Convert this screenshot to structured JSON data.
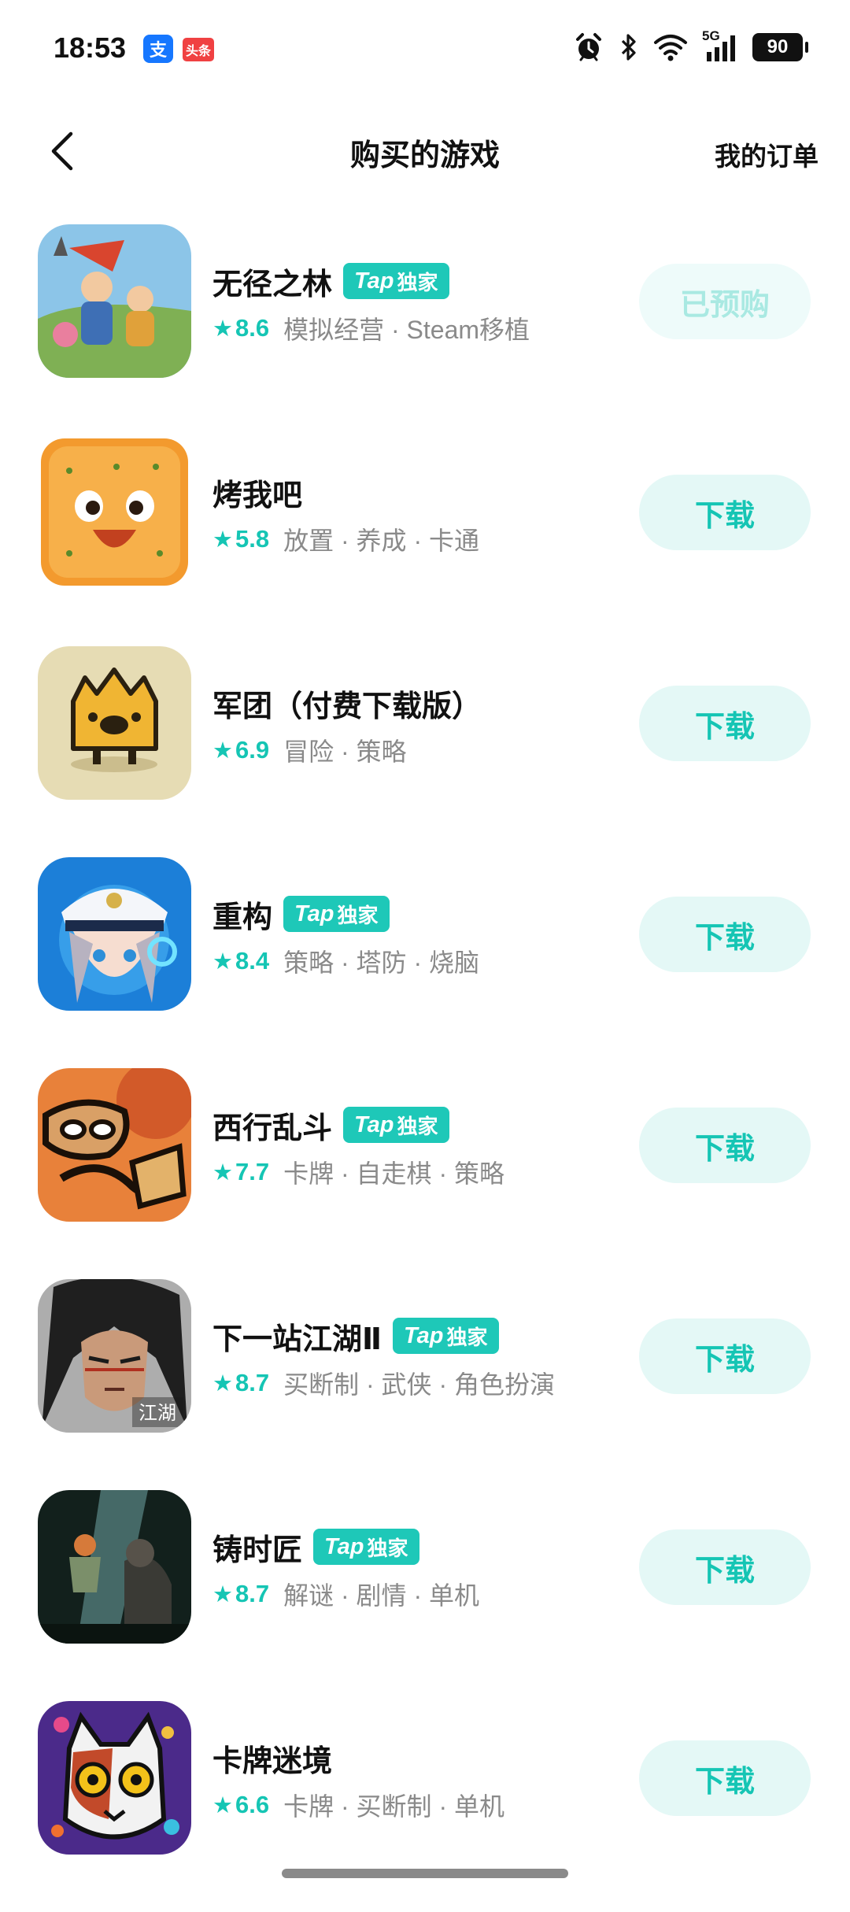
{
  "status_bar": {
    "time": "18:53",
    "alipay_icon": "支",
    "toutiao_icon": "头条",
    "network": "5G",
    "battery": "90",
    "icons": [
      "alarm-icon",
      "bluetooth-icon",
      "wifi-icon",
      "signal-icon",
      "battery-icon"
    ]
  },
  "header": {
    "title": "购买的游戏",
    "orders": "我的订单",
    "back_icon": "chevron-left-icon"
  },
  "tap_badge": {
    "tap": "Tap",
    "text": "独家"
  },
  "games": [
    {
      "title": "无径之林",
      "exclusive": true,
      "rating": "8.6",
      "tags": "模拟经营 · Steam移植",
      "action": "已预购",
      "action_state": "done"
    },
    {
      "title": "烤我吧",
      "exclusive": false,
      "rating": "5.8",
      "tags": "放置 · 养成 · 卡通",
      "action": "下载",
      "action_state": "download"
    },
    {
      "title": "军团（付费下载版）",
      "exclusive": false,
      "rating": "6.9",
      "tags": "冒险 · 策略",
      "action": "下载",
      "action_state": "download"
    },
    {
      "title": "重构",
      "exclusive": true,
      "rating": "8.4",
      "tags": "策略 · 塔防 · 烧脑",
      "action": "下载",
      "action_state": "download"
    },
    {
      "title": "西行乱斗",
      "exclusive": true,
      "rating": "7.7",
      "tags": "卡牌 · 自走棋 · 策略",
      "action": "下载",
      "action_state": "download"
    },
    {
      "title": "下一站江湖Ⅱ",
      "exclusive": true,
      "rating": "8.7",
      "tags": "买断制 · 武侠 · 角色扮演",
      "action": "下载",
      "action_state": "download"
    },
    {
      "title": "铸时匠",
      "exclusive": true,
      "rating": "8.7",
      "tags": "解谜 · 剧情 · 单机",
      "action": "下载",
      "action_state": "download"
    },
    {
      "title": "卡牌迷境",
      "exclusive": false,
      "rating": "6.6",
      "tags": "卡牌 · 买断制 · 单机",
      "action": "下载",
      "action_state": "download"
    }
  ],
  "icon_texts": {
    "jianghu": "江湖"
  },
  "colors": {
    "accent": "#15c5b4",
    "badge": "#1ec8b8",
    "button_bg": "#e4f8f6",
    "button_done_text": "#a9e9e2"
  }
}
